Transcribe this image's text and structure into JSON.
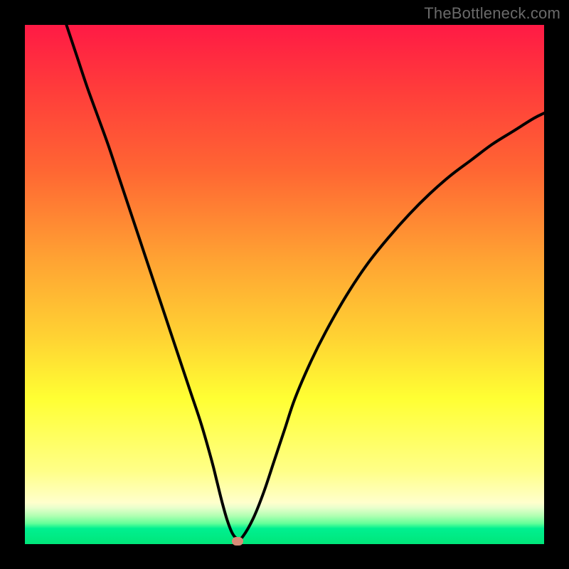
{
  "watermark": "TheBottleneck.com",
  "colors": {
    "frame": "#000000",
    "gradient_top": "#ff1a45",
    "gradient_bottom": "#00e67a",
    "curve": "#000000",
    "marker": "#d98b77"
  },
  "chart_data": {
    "type": "line",
    "title": "",
    "xlabel": "",
    "ylabel": "",
    "xlim": [
      0,
      100
    ],
    "ylim": [
      0,
      100
    ],
    "grid": false,
    "legend": false,
    "series": [
      {
        "name": "bottleneck-curve",
        "x": [
          8,
          10,
          12,
          14,
          16,
          18,
          20,
          22,
          24,
          26,
          28,
          30,
          32,
          34,
          36,
          37,
          38,
          39,
          40,
          41,
          42,
          44,
          46,
          48,
          50,
          52,
          55,
          58,
          62,
          66,
          70,
          74,
          78,
          82,
          86,
          90,
          94,
          98,
          100
        ],
        "values": [
          100,
          94,
          88,
          82.5,
          77,
          71,
          65,
          59,
          53,
          47,
          41,
          35,
          29,
          23,
          16,
          12,
          8,
          4.5,
          2,
          1,
          1.5,
          5,
          10,
          16,
          22,
          28,
          35,
          41,
          48,
          54,
          59,
          63.5,
          67.5,
          71,
          74,
          77,
          79.5,
          82,
          83
        ]
      }
    ],
    "marker": {
      "x": 41,
      "y": 0.5
    }
  }
}
